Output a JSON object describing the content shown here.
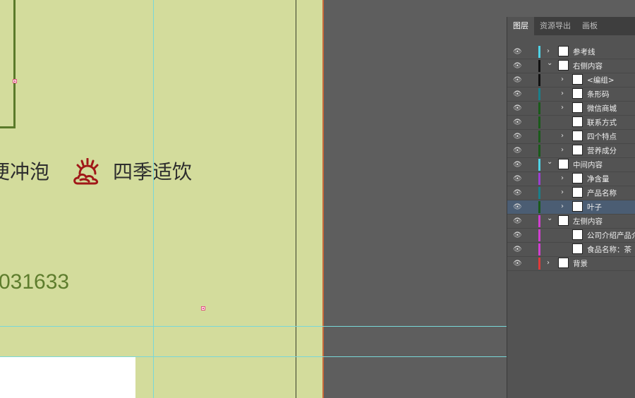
{
  "canvas": {
    "feature_1_text": "便冲泡",
    "feature_2_text": "四季适饮",
    "phone_text": "031633"
  },
  "panel": {
    "tabs": [
      {
        "label": "图层",
        "active": true
      },
      {
        "label": "资源导出",
        "active": false
      },
      {
        "label": "画板",
        "active": false
      }
    ],
    "layers": [
      {
        "label": "参考线",
        "color": "#4fd3e6",
        "expanded": false,
        "indent": 0,
        "selected": false
      },
      {
        "label": "右侧内容",
        "color": "#111111",
        "expanded": true,
        "indent": 0,
        "selected": false
      },
      {
        "label": "<编组>",
        "color": "#111111",
        "expanded": false,
        "indent": 1,
        "selected": false
      },
      {
        "label": "条形码",
        "color": "#1a7f8a",
        "expanded": false,
        "indent": 1,
        "selected": false
      },
      {
        "label": "微信商城",
        "color": "#1a5a1a",
        "expanded": false,
        "indent": 1,
        "selected": false
      },
      {
        "label": "联系方式",
        "color": "#1a5a1a",
        "expanded": null,
        "indent": 1,
        "selected": false
      },
      {
        "label": "四个特点",
        "color": "#1a5a1a",
        "expanded": false,
        "indent": 1,
        "selected": false
      },
      {
        "label": "营养成分",
        "color": "#1a5a1a",
        "expanded": false,
        "indent": 1,
        "selected": false
      },
      {
        "label": "中间内容",
        "color": "#4fd3e6",
        "expanded": true,
        "indent": 0,
        "selected": false
      },
      {
        "label": "净含量",
        "color": "#9b3fd1",
        "expanded": false,
        "indent": 1,
        "selected": false
      },
      {
        "label": "产品名称",
        "color": "#1a7f8a",
        "expanded": false,
        "indent": 1,
        "selected": false
      },
      {
        "label": "叶子",
        "color": "#1a5a1a",
        "expanded": false,
        "indent": 1,
        "selected": true
      },
      {
        "label": "左侧内容",
        "color": "#d13fd1",
        "expanded": true,
        "indent": 0,
        "selected": false
      },
      {
        "label": "公司介绍产品介",
        "color": "#d13fd1",
        "expanded": null,
        "indent": 1,
        "selected": false
      },
      {
        "label": "食品名称：茶",
        "color": "#d13fd1",
        "expanded": null,
        "indent": 1,
        "selected": false
      },
      {
        "label": "背景",
        "color": "#e03a3a",
        "expanded": false,
        "indent": 0,
        "selected": false
      }
    ]
  }
}
